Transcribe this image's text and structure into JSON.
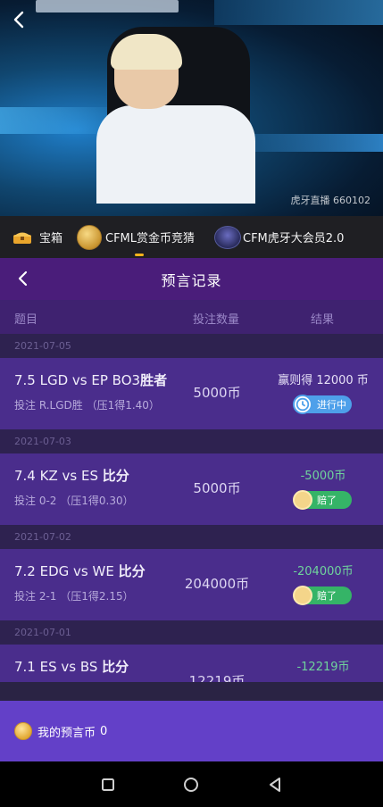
{
  "video": {
    "watermark": "虎牙直播 660102"
  },
  "tabs": [
    {
      "label": "宝箱",
      "icon": "treasure-chest-icon"
    },
    {
      "label": "CFML赏金币竞猜",
      "icon": "gold-coin-icon"
    },
    {
      "label": "CFM虎牙大会员2.0",
      "icon": "vip-badge-icon"
    }
  ],
  "header": {
    "title": "预言记录"
  },
  "columns": {
    "topic": "题目",
    "amount": "投注数量",
    "result": "结果"
  },
  "records": [
    {
      "date": "2021-07-05",
      "title_prefix": "7.5 LGD vs EP BO3",
      "title_suffix": "胜者",
      "bet": "投注 R.LGD胜 （压1得1.40）",
      "amount": "5000币",
      "result": "赢则得 12000 币",
      "status": "进行中"
    },
    {
      "date": "2021-07-03",
      "title_prefix": "7.4 KZ vs ES ",
      "title_suffix": "比分",
      "bet": "投注 0-2 （压1得0.30）",
      "amount": "5000币",
      "result": "-5000币",
      "status": "赔了"
    },
    {
      "date": "2021-07-02",
      "title_prefix": "7.2 EDG vs WE ",
      "title_suffix": "比分",
      "bet": "投注 2-1 （压1得2.15）",
      "amount": "204000币",
      "result": "-204000币",
      "status": "赔了"
    },
    {
      "date": "2021-07-01",
      "title_prefix": "7.1 ES vs BS ",
      "title_suffix": "比分",
      "bet": "",
      "amount": "12219币",
      "result": "-12219币",
      "status": ""
    }
  ],
  "footer": {
    "my_coins_label": "我的预言币",
    "my_coins_value": "0"
  }
}
